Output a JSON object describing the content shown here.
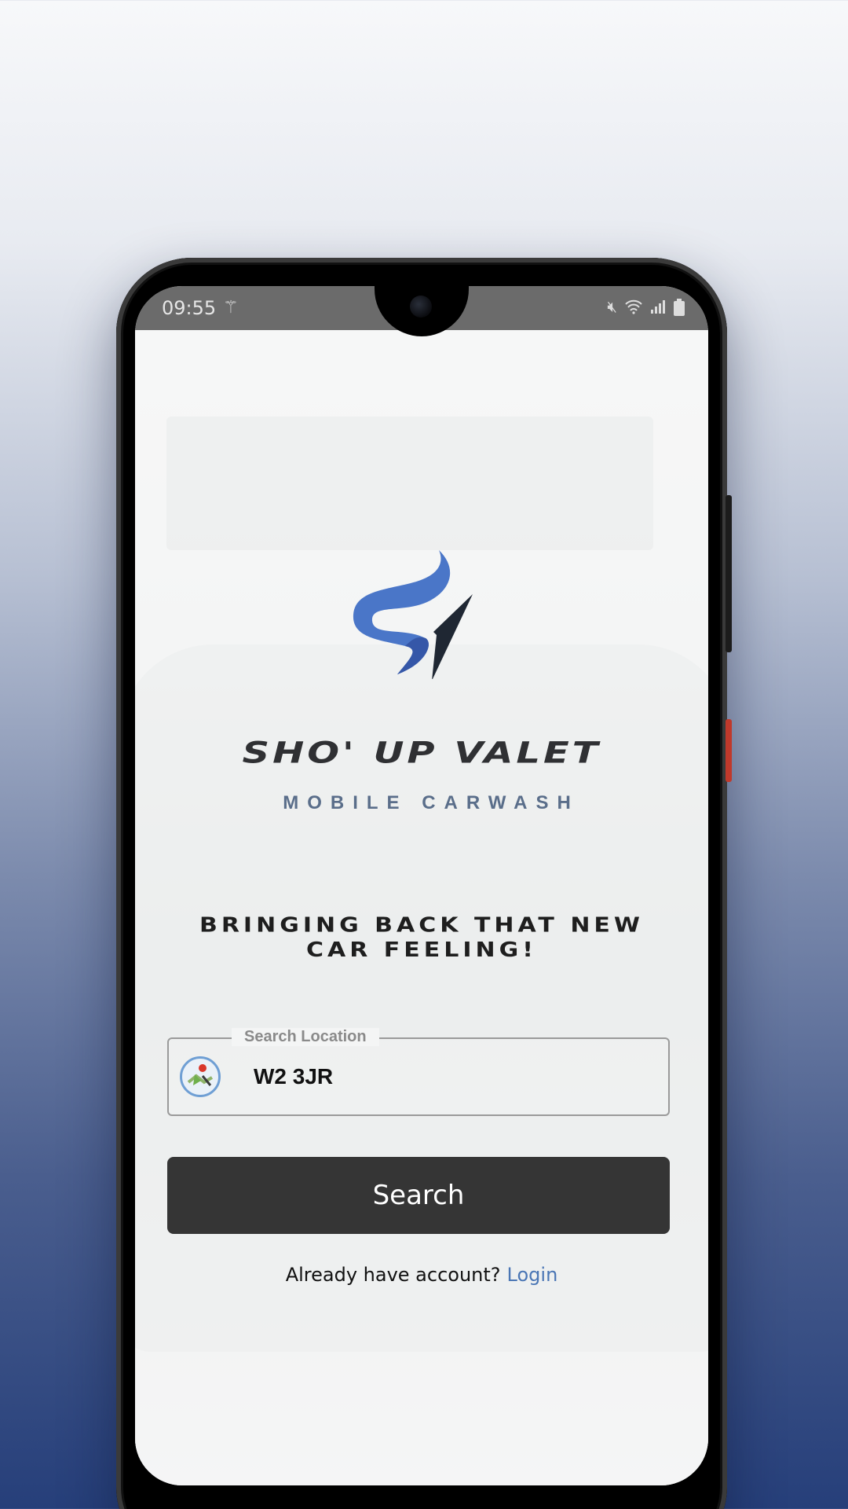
{
  "status_bar": {
    "time": "09:55"
  },
  "brand": {
    "name": "SHO' UP VALET",
    "subtitle": "MOBILE CARWASH",
    "colors": {
      "logo_blue": "#4a76c8",
      "logo_dark": "#1f2733"
    }
  },
  "tagline": "BRINGING BACK THAT NEW CAR FEELING!",
  "search": {
    "label": "Search Location",
    "value": "W2 3JR",
    "button_label": "Search"
  },
  "account": {
    "prompt": "Already have account?",
    "login_label": "Login"
  }
}
